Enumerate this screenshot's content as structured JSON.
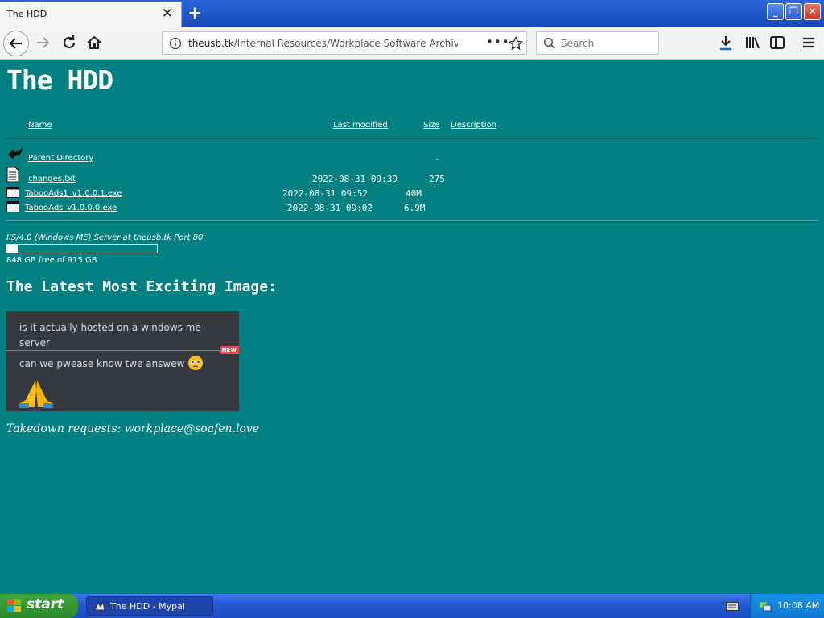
{
  "browser": {
    "tab_title": "The HDD",
    "url_host": "theusb.tk",
    "url_path": "/Internal Resources/Workplace Software Archive",
    "search_placeholder": "Search"
  },
  "page": {
    "title": "The HDD",
    "columns": {
      "name": "Name",
      "modified": "Last modified",
      "size": "Size",
      "description": "Description"
    },
    "parent": {
      "label": "Parent Directory",
      "size": "-"
    },
    "files": [
      {
        "name": "changes.txt",
        "modified": "2022-08-31 09:39",
        "size": "275",
        "icon": "text-file-icon"
      },
      {
        "name": "TabooAds1_v1.0.0.1.exe",
        "modified": "2022-08-31 09:52",
        "size": "40M",
        "icon": "exe-file-icon"
      },
      {
        "name": "TabooAds_v1.0.0.0.exe",
        "modified": "2022-08-31 09:02",
        "size": "6.9M",
        "icon": "exe-file-icon"
      }
    ],
    "server_signature": "IIS/4.0 (Windows ME) Server at theusb.tk Port 80",
    "disk": {
      "free_text": "848 GB free of 915 GB",
      "used_fraction": 0.07
    },
    "section_heading": "The Latest Most Exciting Image:",
    "image_chat": {
      "line1": "is it actually hosted on a windows me server",
      "line2": "can we pwease know twe answew",
      "new_badge": "NEW"
    },
    "takedown": "Takedown requests: workplace@soafen.love"
  },
  "taskbar": {
    "start_label": "start",
    "task_label": "The HDD - Mypal",
    "clock": "10:08 AM"
  },
  "colors": {
    "page_bg": "#008080",
    "taskbar": "#2659d3",
    "start": "#2a8a2a"
  }
}
